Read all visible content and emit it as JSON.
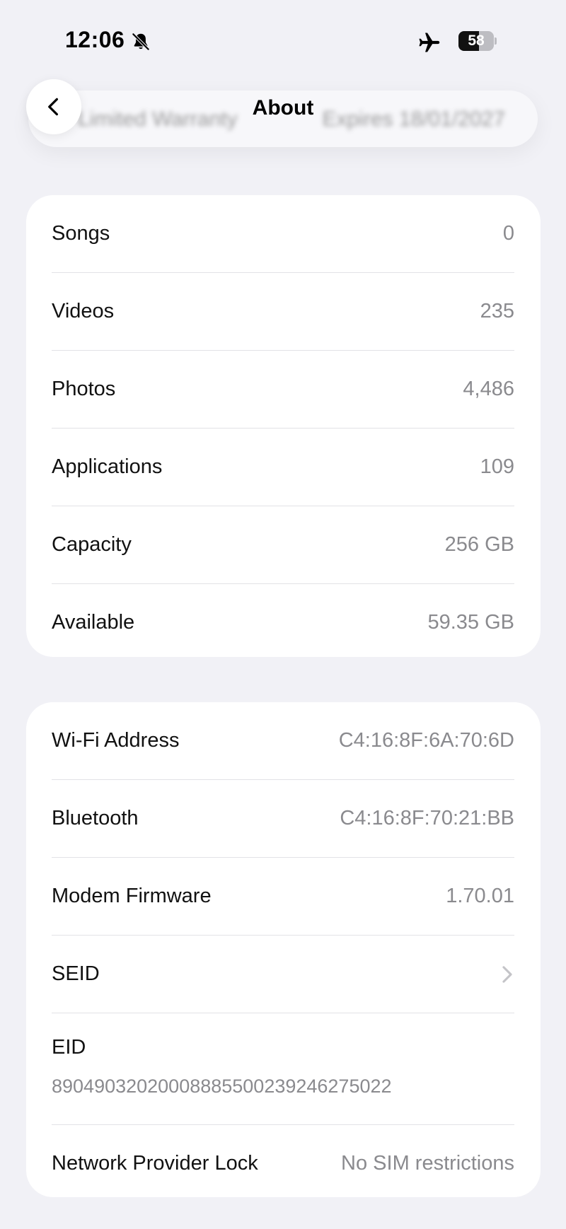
{
  "status_bar": {
    "time": "12:06",
    "battery_level": "58",
    "battery_fraction": 0.58,
    "icons": [
      "bell-slash-icon",
      "airplane-icon",
      "battery-icon"
    ]
  },
  "header": {
    "title": "About",
    "back_icon": "chevron-left-icon",
    "blurred_left_text": "Limited Warranty",
    "blurred_right_text": "Expires 18/01/2027"
  },
  "storage": {
    "rows": [
      {
        "label": "Songs",
        "value": "0"
      },
      {
        "label": "Videos",
        "value": "235"
      },
      {
        "label": "Photos",
        "value": "4,486"
      },
      {
        "label": "Applications",
        "value": "109"
      },
      {
        "label": "Capacity",
        "value": "256 GB"
      },
      {
        "label": "Available",
        "value": "59.35 GB"
      }
    ]
  },
  "network": {
    "wifi": {
      "label": "Wi-Fi Address",
      "value": "C4:16:8F:6A:70:6D"
    },
    "bluetooth": {
      "label": "Bluetooth",
      "value": "C4:16:8F:70:21:BB"
    },
    "modem": {
      "label": "Modem Firmware",
      "value": "1.70.01"
    },
    "seid": {
      "label": "SEID",
      "icon": "chevron-right-icon"
    },
    "eid": {
      "label": "EID",
      "value": "89049032020008885500239246275022"
    },
    "lock": {
      "label": "Network Provider Lock",
      "value": "No SIM restrictions"
    }
  },
  "colors": {
    "background": "#f1f1f6",
    "card": "#ffffff",
    "secondary_text": "#8a8a8e",
    "separator": "#e2e2e6"
  }
}
